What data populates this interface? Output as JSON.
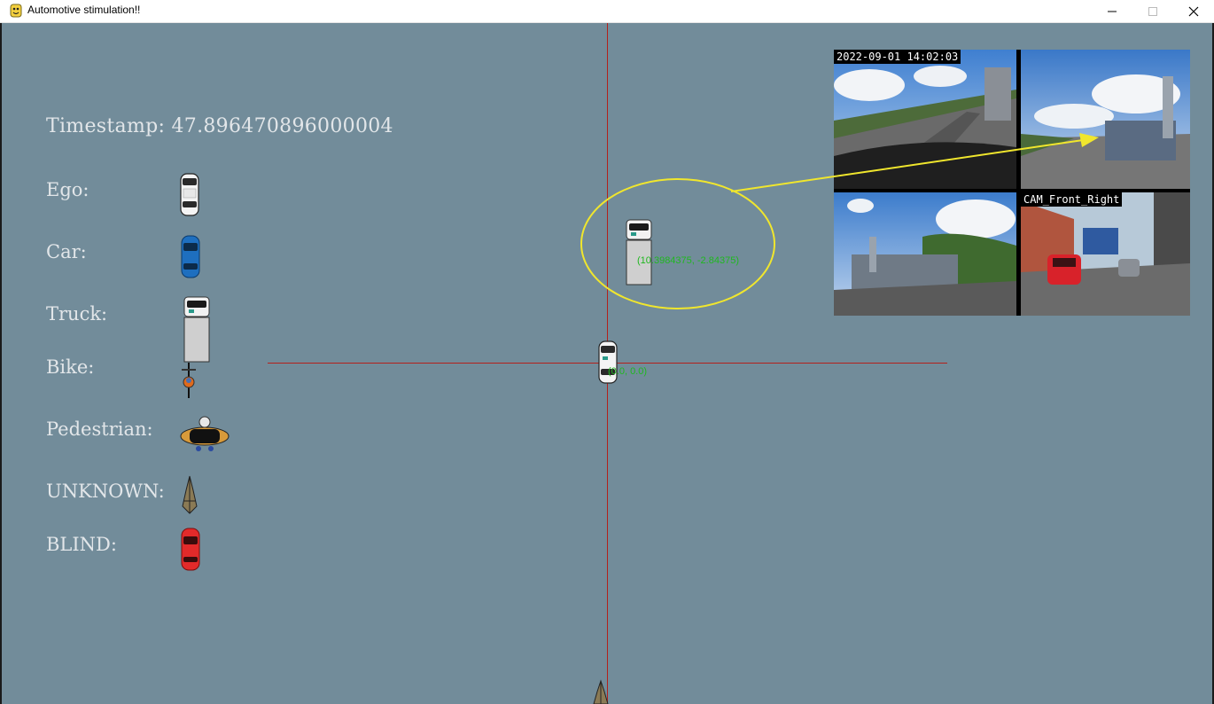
{
  "window": {
    "title": "Automotive stimulation!!"
  },
  "legend": {
    "timestamp": "Timestamp: 47.896470896000004",
    "items": [
      {
        "label": "Ego:",
        "icon": "ego-car-icon"
      },
      {
        "label": "Car:",
        "icon": "blue-car-icon"
      },
      {
        "label": "Truck:",
        "icon": "truck-icon"
      },
      {
        "label": "Bike:",
        "icon": "bike-icon"
      },
      {
        "label": "Pedestrian:",
        "icon": "pedestrian-icon"
      },
      {
        "label": "UNKNOWN:",
        "icon": "unknown-icon"
      },
      {
        "label": "BLIND:",
        "icon": "red-car-icon"
      }
    ]
  },
  "scene": {
    "ego_coord": "(0.0, 0.0)",
    "truck_coord": "(10.3984375, -2.84375)"
  },
  "cameras": {
    "timestamp_overlay": "2022-09-01 14:02:03",
    "front_right_label": "CAM_Front_Right"
  },
  "colors": {
    "background": "#728c9a",
    "axis_line": "#b3201b",
    "coord_text": "#1fb81f",
    "highlight": "#f0e62d"
  }
}
